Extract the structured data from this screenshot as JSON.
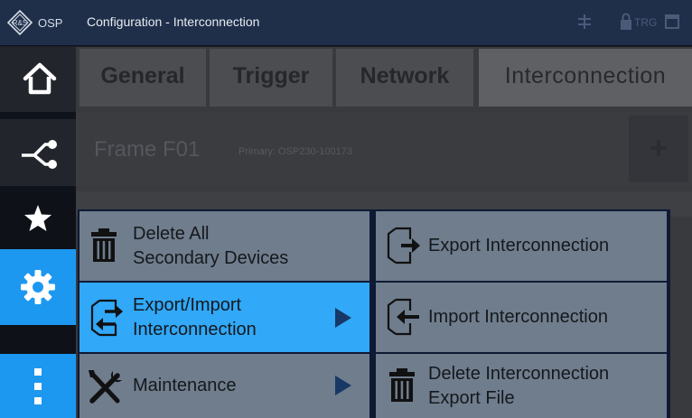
{
  "titlebar": {
    "logo_text": "OSP",
    "logo_mark": "R&S",
    "title": "Configuration - Interconnection",
    "status": {
      "trg_label": "TRG",
      "icons": [
        "interconnect-status-icon",
        "lock-icon",
        "window-icon"
      ]
    }
  },
  "sidebar": {
    "items": [
      {
        "name": "home",
        "icon": "home-icon"
      },
      {
        "name": "network",
        "icon": "network-icon"
      },
      {
        "name": "favorites",
        "icon": "star-icon"
      },
      {
        "name": "configuration",
        "icon": "gear-icon",
        "active": true
      },
      {
        "name": "more",
        "icon": "more-vertical-icon"
      }
    ]
  },
  "tabs": [
    {
      "label": "General"
    },
    {
      "label": "Trigger"
    },
    {
      "label": "Network"
    },
    {
      "label": "Interconnection",
      "active": true
    }
  ],
  "frame": {
    "title": "Frame F01",
    "primary": "Primary: OSP230-100173",
    "add_label": "+"
  },
  "menu": {
    "left": [
      {
        "label": "Delete All\nSecondary Devices",
        "icon": "trash-icon"
      },
      {
        "label": "Export/Import\nInterconnection",
        "icon": "export-import-icon",
        "submenu": true,
        "selected": true
      },
      {
        "label": "Maintenance",
        "icon": "tools-icon",
        "submenu": true
      }
    ],
    "right": [
      {
        "label": "Export Interconnection",
        "icon": "export-icon"
      },
      {
        "label": "Import Interconnection",
        "icon": "import-icon"
      },
      {
        "label": "Delete Interconnection\nExport File",
        "icon": "trash-icon"
      }
    ]
  },
  "colors": {
    "titlebar": "#1f2f4a",
    "accent": "#1c98f0",
    "menu_item": "#6f7d8d",
    "menu_selected": "#31a8f8",
    "menu_border": "#0e1a33",
    "submenu_arrow": "#183866"
  }
}
